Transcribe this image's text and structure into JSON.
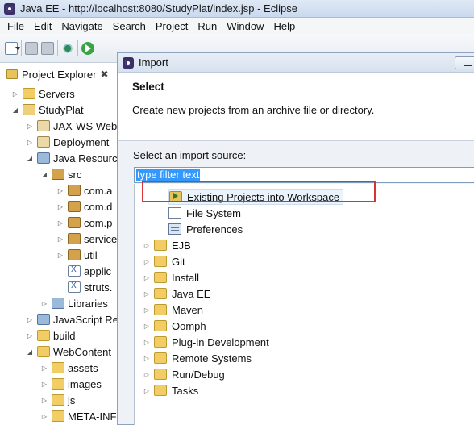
{
  "window": {
    "title": "Java EE - http://localhost:8080/StudyPlat/index.jsp - Eclipse"
  },
  "menu": [
    "File",
    "Edit",
    "Navigate",
    "Search",
    "Project",
    "Run",
    "Window",
    "Help"
  ],
  "explorer": {
    "tab_label": "Project Explorer",
    "close_glyph": "✖",
    "items": [
      {
        "label": "Servers",
        "icon": "folder-icon",
        "expanded": false
      },
      {
        "label": "StudyPlat",
        "icon": "project-icon",
        "expanded": true
      },
      {
        "label": "JAX-WS Web",
        "icon": "service-icon",
        "expanded": false
      },
      {
        "label": "Deployment",
        "icon": "deployment-icon",
        "expanded": false
      },
      {
        "label": "Java Resourc",
        "icon": "java-resources-icon",
        "expanded": true
      },
      {
        "label": "src",
        "icon": "package-root-icon",
        "expanded": true
      },
      {
        "label": "com.a",
        "icon": "package-icon",
        "expanded": false
      },
      {
        "label": "com.d",
        "icon": "package-icon",
        "expanded": false
      },
      {
        "label": "com.p",
        "icon": "package-icon",
        "expanded": false
      },
      {
        "label": "service",
        "icon": "package-icon",
        "expanded": false
      },
      {
        "label": "util",
        "icon": "package-icon",
        "expanded": false
      },
      {
        "label": "applic",
        "icon": "xml-file-icon",
        "expanded": null
      },
      {
        "label": "struts.",
        "icon": "xml-file-icon",
        "expanded": null
      },
      {
        "label": "Libraries",
        "icon": "library-icon",
        "expanded": false
      },
      {
        "label": "JavaScript Re",
        "icon": "javascript-resources-icon",
        "expanded": false
      },
      {
        "label": "build",
        "icon": "folder-icon",
        "expanded": false
      },
      {
        "label": "WebContent",
        "icon": "folder-icon",
        "expanded": true
      },
      {
        "label": "assets",
        "icon": "folder-icon",
        "expanded": false
      },
      {
        "label": "images",
        "icon": "folder-icon",
        "expanded": false
      },
      {
        "label": "js",
        "icon": "folder-icon",
        "expanded": false
      },
      {
        "label": "META-INF",
        "icon": "folder-icon",
        "expanded": false
      }
    ]
  },
  "dialog": {
    "title": "Import",
    "heading": "Select",
    "description": "Create new projects from an archive file or directory.",
    "source_label": "Select an import source:",
    "filter_value": "type filter text",
    "list": [
      {
        "label": "Existing Projects into Workspace",
        "icon": "import-project-icon",
        "highlighted": true
      },
      {
        "label": "File System",
        "icon": "file-system-icon"
      },
      {
        "label": "Preferences",
        "icon": "preferences-icon"
      },
      {
        "label": "EJB",
        "icon": "folder-icon"
      },
      {
        "label": "Git",
        "icon": "folder-icon"
      },
      {
        "label": "Install",
        "icon": "folder-icon"
      },
      {
        "label": "Java EE",
        "icon": "folder-icon"
      },
      {
        "label": "Maven",
        "icon": "folder-icon"
      },
      {
        "label": "Oomph",
        "icon": "folder-icon"
      },
      {
        "label": "Plug-in Development",
        "icon": "folder-icon"
      },
      {
        "label": "Remote Systems",
        "icon": "folder-icon"
      },
      {
        "label": "Run/Debug",
        "icon": "folder-icon"
      },
      {
        "label": "Tasks",
        "icon": "folder-icon"
      }
    ]
  },
  "colors": {
    "selection": "#3399ff",
    "annotation_box": "#d9333a"
  }
}
